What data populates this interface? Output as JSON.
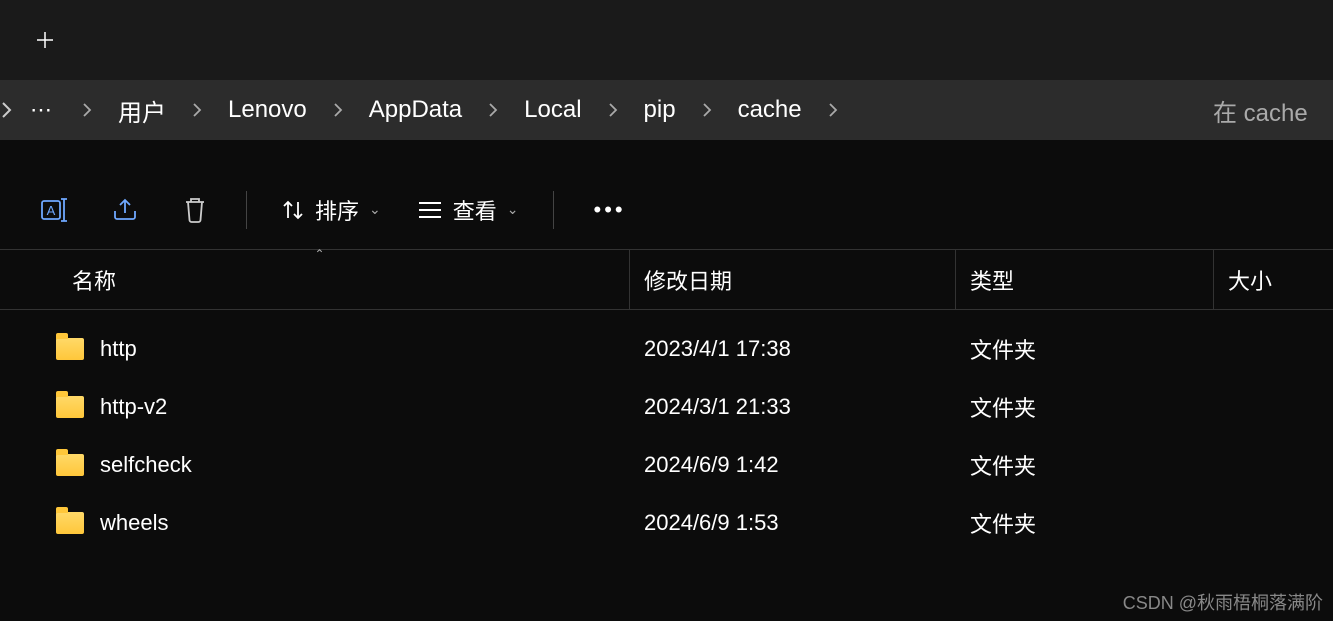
{
  "breadcrumb": {
    "items": [
      "用户",
      "Lenovo",
      "AppData",
      "Local",
      "pip",
      "cache"
    ]
  },
  "search": {
    "placeholder": "在 cache"
  },
  "toolbar": {
    "sort_label": "排序",
    "view_label": "查看"
  },
  "columns": {
    "name": "名称",
    "date": "修改日期",
    "type": "类型",
    "size": "大小"
  },
  "files": [
    {
      "name": "http",
      "date": "2023/4/1 17:38",
      "type": "文件夹",
      "size": ""
    },
    {
      "name": "http-v2",
      "date": "2024/3/1 21:33",
      "type": "文件夹",
      "size": ""
    },
    {
      "name": "selfcheck",
      "date": "2024/6/9 1:42",
      "type": "文件夹",
      "size": ""
    },
    {
      "name": "wheels",
      "date": "2024/6/9 1:53",
      "type": "文件夹",
      "size": ""
    }
  ],
  "watermark": "CSDN @秋雨梧桐落满阶"
}
